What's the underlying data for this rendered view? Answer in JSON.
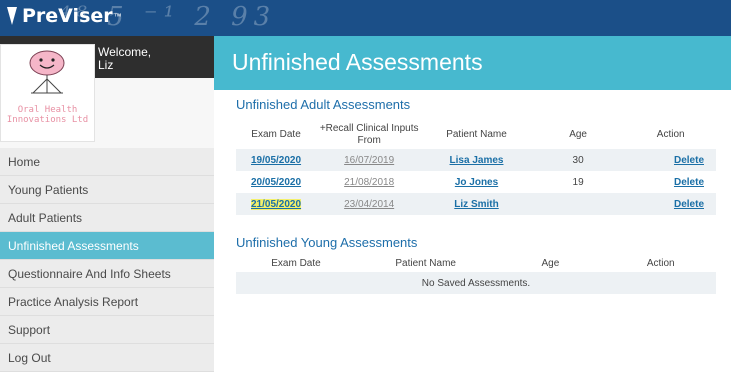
{
  "brand": {
    "name": "PreViser",
    "tm": "™",
    "deco": "⁴⁸ 5 ⁻¹ 2 93"
  },
  "profile": {
    "welcome_line1": "Welcome,",
    "welcome_line2": "Liz",
    "logo_text": "Oral Health Innovations Ltd"
  },
  "nav": {
    "items": [
      {
        "label": "Home"
      },
      {
        "label": "Young Patients"
      },
      {
        "label": "Adult Patients"
      },
      {
        "label": "Unfinished Assessments"
      },
      {
        "label": "Questionnaire And Info Sheets"
      },
      {
        "label": "Practice Analysis Report"
      },
      {
        "label": "Support"
      },
      {
        "label": "Log Out"
      }
    ]
  },
  "page": {
    "title": "Unfinished Assessments"
  },
  "adult": {
    "title": "Unfinished Adult Assessments",
    "headers": [
      "Exam Date",
      "+Recall Clinical Inputs From",
      "Patient Name",
      "Age",
      "Action"
    ],
    "rows": [
      {
        "exam_date": "19/05/2020",
        "recall_from": "16/07/2019",
        "patient": "Lisa James",
        "age": "30",
        "action": "Delete"
      },
      {
        "exam_date": "20/05/2020",
        "recall_from": "21/08/2018",
        "patient": "Jo Jones",
        "age": "19",
        "action": "Delete"
      },
      {
        "exam_date": "21/05/2020",
        "recall_from": "23/04/2014",
        "patient": "Liz Smith",
        "age": "",
        "action": "Delete"
      }
    ]
  },
  "young": {
    "title": "Unfinished Young Assessments",
    "headers": [
      "Exam Date",
      "Patient Name",
      "Age",
      "Action"
    ],
    "empty": "No Saved Assessments."
  },
  "colors": {
    "topbar": "#1b4f88",
    "accent": "#47b9cf",
    "nav_active": "#5bbcd0",
    "link": "#1a6fa6",
    "highlight": "#f4f06a"
  }
}
